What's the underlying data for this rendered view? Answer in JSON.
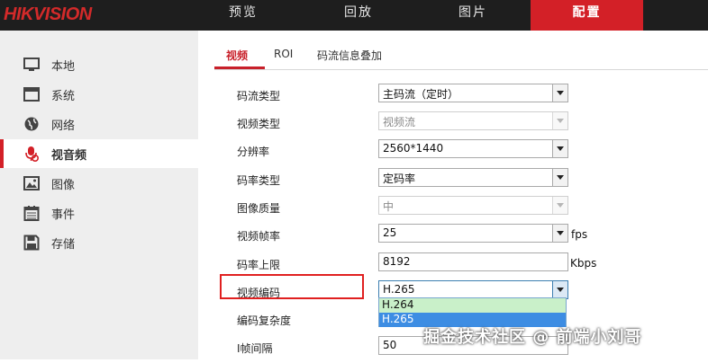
{
  "brand": "HIKVISION",
  "nav": [
    {
      "label": "预览",
      "active": false
    },
    {
      "label": "回放",
      "active": false
    },
    {
      "label": "图片",
      "active": false
    },
    {
      "label": "配置",
      "active": true
    }
  ],
  "sidebar": {
    "items": [
      {
        "label": "本地",
        "icon": "monitor-icon"
      },
      {
        "label": "系统",
        "icon": "window-icon"
      },
      {
        "label": "网络",
        "icon": "globe-icon"
      },
      {
        "label": "视音频",
        "icon": "microphone-icon",
        "active": true
      },
      {
        "label": "图像",
        "icon": "image-icon"
      },
      {
        "label": "事件",
        "icon": "calendar-icon"
      },
      {
        "label": "存储",
        "icon": "floppy-disk-icon"
      }
    ]
  },
  "tabs": [
    {
      "label": "视频",
      "active": true
    },
    {
      "label": "ROI"
    },
    {
      "label": "码流信息叠加"
    }
  ],
  "form": {
    "stream_type": {
      "label": "码流类型",
      "value": "主码流（定时）"
    },
    "video_type": {
      "label": "视频类型",
      "value": "视频流"
    },
    "resolution": {
      "label": "分辨率",
      "value": "2560*1440"
    },
    "bitrate_type": {
      "label": "码率类型",
      "value": "定码率"
    },
    "image_quality": {
      "label": "图像质量",
      "value": "中"
    },
    "frame_rate": {
      "label": "视频帧率",
      "value": "25",
      "unit": "fps"
    },
    "bitrate_limit": {
      "label": "码率上限",
      "value": "8192",
      "unit": "Kbps"
    },
    "video_encoding": {
      "label": "视频编码",
      "value": "H.265",
      "options": [
        "H.264",
        "H.265"
      ]
    },
    "encoding_complexity": {
      "label": "编码复杂度"
    },
    "i_frame_interval": {
      "label": "I帧间隔",
      "value": "50"
    }
  },
  "watermark": "掘金技术社区 @ 前端小刘哥",
  "colors": {
    "accent": "#d32027",
    "topbar": "#1e1e1e",
    "sidebar": "#eeeeee"
  }
}
